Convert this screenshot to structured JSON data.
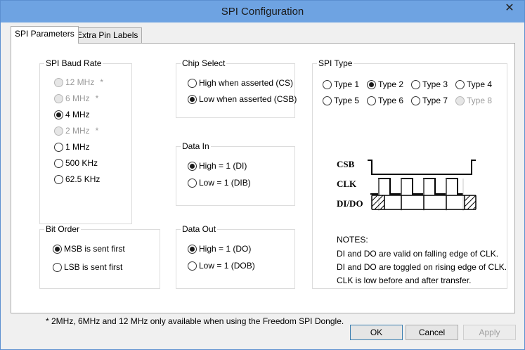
{
  "window": {
    "title": "SPI Configuration",
    "close_glyph": "✕"
  },
  "tabs": [
    {
      "label": "SPI Parameters"
    },
    {
      "label": "Extra Pin Labels"
    }
  ],
  "baud_rate": {
    "title": "SPI Baud Rate",
    "options": [
      {
        "label": "12 MHz",
        "star": "*",
        "checked": false,
        "disabled": true
      },
      {
        "label": "6 MHz",
        "star": "*",
        "checked": false,
        "disabled": true
      },
      {
        "label": "4 MHz",
        "star": "",
        "checked": true,
        "disabled": false
      },
      {
        "label": "2 MHz",
        "star": "*",
        "checked": false,
        "disabled": true
      },
      {
        "label": "1 MHz",
        "star": "",
        "checked": false,
        "disabled": false
      },
      {
        "label": "500 KHz",
        "star": "",
        "checked": false,
        "disabled": false
      },
      {
        "label": "62.5 KHz",
        "star": "",
        "checked": false,
        "disabled": false
      }
    ]
  },
  "chip_select": {
    "title": "Chip Select",
    "options": [
      {
        "label": "High when asserted (CS)",
        "checked": false
      },
      {
        "label": "Low when asserted (CSB)",
        "checked": true
      }
    ]
  },
  "data_in": {
    "title": "Data In",
    "options": [
      {
        "label": "High = 1 (DI)",
        "checked": true
      },
      {
        "label": "Low = 1 (DIB)",
        "checked": false
      }
    ]
  },
  "data_out": {
    "title": "Data Out",
    "options": [
      {
        "label": "High = 1 (DO)",
        "checked": true
      },
      {
        "label": "Low = 1 (DOB)",
        "checked": false
      }
    ]
  },
  "bit_order": {
    "title": "Bit Order",
    "options": [
      {
        "label": "MSB is sent first",
        "checked": true
      },
      {
        "label": "LSB is sent first",
        "checked": false
      }
    ]
  },
  "spi_type": {
    "title": "SPI Type",
    "options": [
      {
        "label": "Type 1",
        "checked": false,
        "disabled": false
      },
      {
        "label": "Type 2",
        "checked": true,
        "disabled": false
      },
      {
        "label": "Type 3",
        "checked": false,
        "disabled": false
      },
      {
        "label": "Type 4",
        "checked": false,
        "disabled": false
      },
      {
        "label": "Type 5",
        "checked": false,
        "disabled": false
      },
      {
        "label": "Type 6",
        "checked": false,
        "disabled": false
      },
      {
        "label": "Type 7",
        "checked": false,
        "disabled": false
      },
      {
        "label": "Type 8",
        "checked": false,
        "disabled": true
      }
    ],
    "diagram_labels": {
      "csb": "CSB",
      "clk": "CLK",
      "dido": "DI/DO"
    },
    "notes_title": "NOTES:",
    "notes": [
      "DI and DO are valid on falling edge of CLK.",
      "DI and DO are toggled on rising edge of CLK.",
      "CLK is low before and after transfer."
    ]
  },
  "footnote": "* 2MHz, 6MHz and 12 MHz only available when using the Freedom SPI Dongle.",
  "buttons": {
    "ok": "OK",
    "cancel": "Cancel",
    "apply": "Apply"
  }
}
